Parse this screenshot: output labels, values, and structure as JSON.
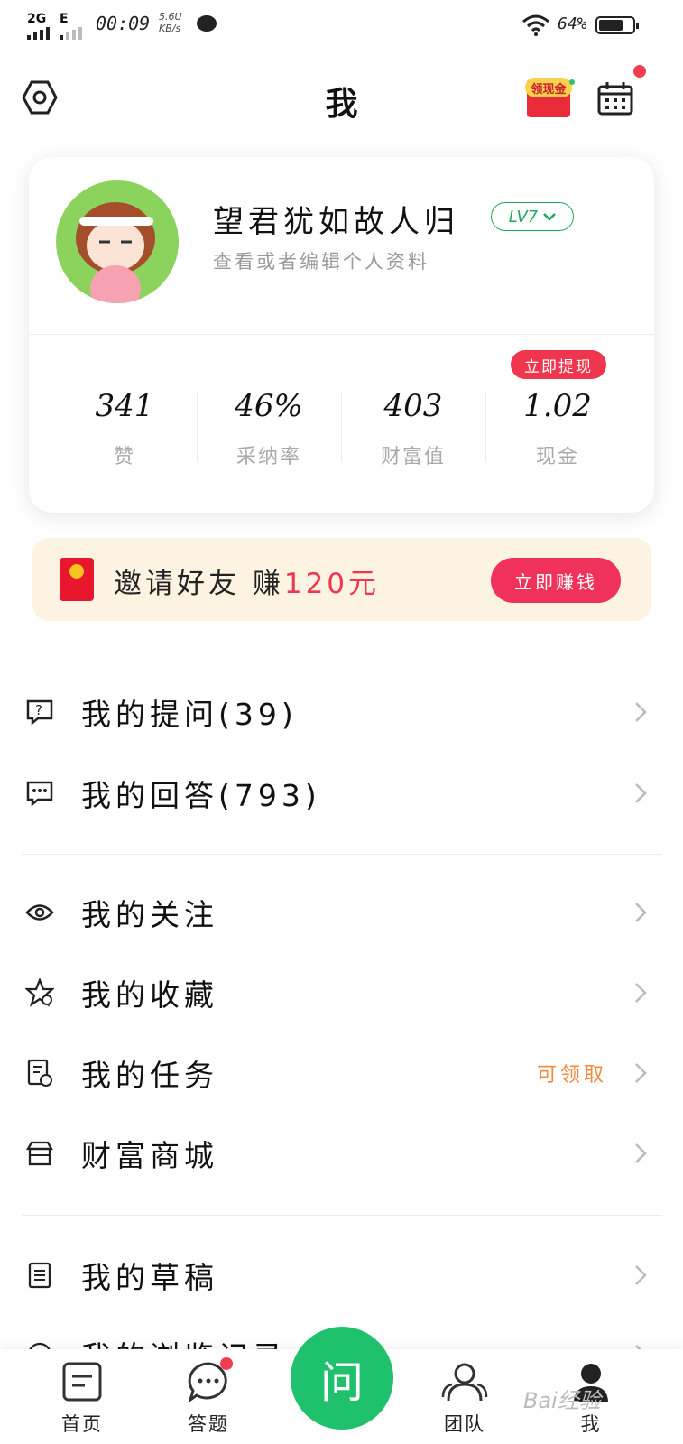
{
  "status_bar": {
    "signal_1": "2G",
    "signal_2": "E",
    "time": "00:09",
    "speed": "5.6U",
    "speed_unit": "KB/s",
    "battery": "64%"
  },
  "header": {
    "title": "我",
    "cash_badge": "领现金"
  },
  "profile": {
    "username": "望君犹如故人归",
    "level": "LV7",
    "subtitle": "查看或者编辑个人资料"
  },
  "stats": [
    {
      "value": "341",
      "label": "赞"
    },
    {
      "value": "46%",
      "label": "采纳率"
    },
    {
      "value": "403",
      "label": "财富值"
    },
    {
      "value": "1.02",
      "label": "现金"
    }
  ],
  "withdraw_badge": "立即提现",
  "invite": {
    "text": "邀请好友  赚",
    "amount": "120元",
    "button": "立即赚钱"
  },
  "menu": [
    {
      "label": "我的提问(39)",
      "icon": "question-icon"
    },
    {
      "label": "我的回答(793)",
      "icon": "answer-icon"
    },
    {
      "label": "我的关注",
      "icon": "eye-icon"
    },
    {
      "label": "我的收藏",
      "icon": "star-icon"
    },
    {
      "label": "我的任务",
      "icon": "task-icon",
      "extra": "可领取"
    },
    {
      "label": "财富商城",
      "icon": "store-icon"
    },
    {
      "label": "我的草稿",
      "icon": "draft-icon"
    },
    {
      "label": "我的浏览记录",
      "icon": "history-icon"
    }
  ],
  "tabs": [
    {
      "label": "首页",
      "icon": "home-icon"
    },
    {
      "label": "答题",
      "icon": "chat-icon"
    },
    {
      "label": "问",
      "icon": "ask-button"
    },
    {
      "label": "团队",
      "icon": "team-icon"
    },
    {
      "label": "我",
      "icon": "me-icon"
    }
  ],
  "watermark": "Bai经验",
  "colors": {
    "brand_green": "#1fc16d",
    "accent_red": "#f0354e",
    "orange": "#ef8a43"
  }
}
